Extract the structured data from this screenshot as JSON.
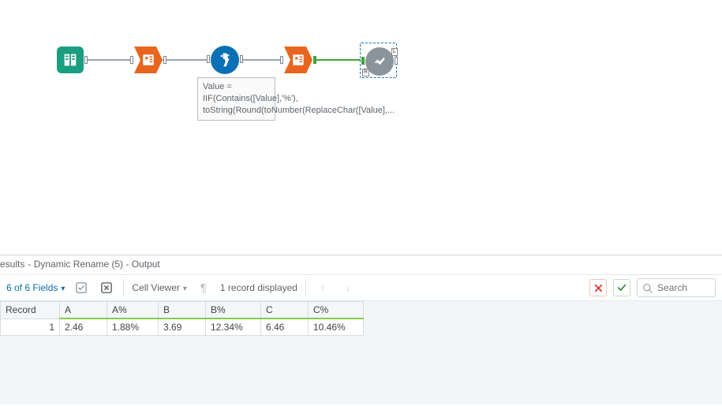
{
  "canvas": {
    "annotation": "Value = IIF(Contains([Value],'%'), toString(Round(toNumber(ReplaceChar([Value],...",
    "nodes": {
      "input": {
        "name": "input-tool"
      },
      "dynrename": {
        "name": "dynamic-rename-tool"
      },
      "formula": {
        "name": "formula-tool"
      },
      "dynrename2": {
        "name": "dynamic-rename-tool-2"
      },
      "browse": {
        "name": "browse-tool"
      }
    },
    "port_badge_L": "L",
    "port_badge_R": "R"
  },
  "results": {
    "header_prefix": "esults",
    "header_rest": " - Dynamic Rename (5) - Output",
    "fields_label": "6 of 6 Fields",
    "cellviewer_label": "Cell Viewer",
    "records_label": "1 record displayed",
    "search_placeholder": "Search",
    "columns": [
      "Record",
      "A",
      "A%",
      "B",
      "B%",
      "C",
      "C%"
    ],
    "widths": [
      75,
      60,
      65,
      60,
      70,
      60,
      70
    ],
    "rows": [
      [
        "1",
        "2.46",
        "1.88%",
        "3.69",
        "12.34%",
        "6.46",
        "10.46%"
      ]
    ]
  }
}
